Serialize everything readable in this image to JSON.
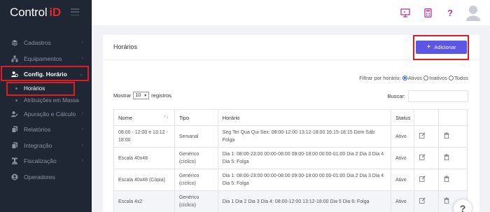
{
  "brand": {
    "name": "Control",
    "suffix": "iD"
  },
  "sidebar": {
    "items": [
      {
        "label": "Cadastros",
        "icon": "layers-icon",
        "chevron": "›"
      },
      {
        "label": "Equipamentos",
        "icon": "network-icon",
        "chevron": "›"
      },
      {
        "label": "Config. Horário",
        "icon": "user-clock-icon",
        "chevron": "⌄"
      }
    ],
    "subitems": [
      {
        "label": "Horários"
      },
      {
        "label": "Atribuições em Massa"
      }
    ],
    "items_after": [
      {
        "label": "Apuração e Cálculo",
        "icon": "user-edit-icon",
        "chevron": "›"
      },
      {
        "label": "Relatórios",
        "icon": "files-icon",
        "chevron": "›"
      },
      {
        "label": "Integração",
        "icon": "files-icon",
        "chevron": "›"
      },
      {
        "label": "Fiscalização",
        "icon": "gavel-icon",
        "chevron": "›"
      },
      {
        "label": "Operadores",
        "icon": "user-circle-icon",
        "chevron": ""
      }
    ]
  },
  "topbar": {
    "icons": [
      "monitor-icon",
      "calculator-icon",
      "help-icon",
      "user-avatar-icon"
    ],
    "help_glyph": "?"
  },
  "card": {
    "title": "Horários",
    "add_button": "Adicionar",
    "add_glyph": "+"
  },
  "filter": {
    "label": "Filtrar por horário:",
    "options": [
      "Ativos",
      "Inativos",
      "Todos"
    ],
    "selected": "Ativos"
  },
  "length": {
    "before": "Mostrar",
    "value": "10",
    "after": "registros"
  },
  "search": {
    "label": "Buscar:",
    "value": ""
  },
  "table": {
    "headers": [
      "Nome",
      "Tipo",
      "Horário",
      "Status"
    ],
    "rows": [
      {
        "nome": "08:00 - 12:00 e 13:12 - 18:00",
        "tipo": "Semanal",
        "horario": "Seg Ter Qua Qui Sex: 08:00-12:00 13:12-18:00 16:15-18:15 Dom Sáb: Folga",
        "status": "Ativo"
      },
      {
        "nome": "Escala 40x48",
        "tipo": "Genérico (cíclico)",
        "horario": "Dia 1: 08:00-23:00 00:00-08:00 09:00-18:00 00:00-01:00 Dia 2 Dia 3 Dia 4 Dia 5: Folga",
        "status": "Ativo"
      },
      {
        "nome": "Escala 40x48 (Cópia)",
        "tipo": "Genérico (cíclico)",
        "horario": "Dia 1: 08:00-23:00 00:00-08:00 09:00-18:00 00:00-01:00 Dia 2 Dia 3 Dia 4 Dia 5: Folga",
        "status": "Ativo"
      },
      {
        "nome": "Escala 4x2",
        "tipo": "Genérico (cíclico)",
        "horario": "Dia 1 Dia 2 Dia 3 Dia 4: 08:00-12:00 13:12-18:00 Dia 5 Dia 6: Folga",
        "status": "Ativo"
      }
    ]
  },
  "help_fab": "?",
  "colors": {
    "sidebar": "#1f2634",
    "accent": "#5b57e4",
    "highlight": "#e11b22",
    "brand_id": "#e4262c",
    "icon_pink": "#c0319c"
  }
}
